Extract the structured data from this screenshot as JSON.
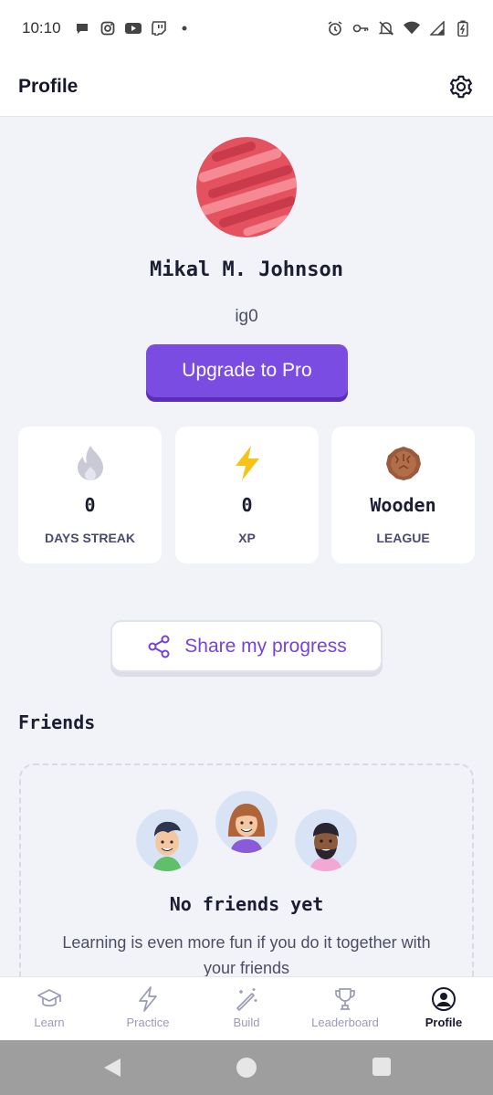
{
  "status_bar": {
    "time": "10:10",
    "notification_icons": [
      "chat-icon",
      "instagram-icon",
      "youtube-icon",
      "twitch-icon",
      "dot-icon"
    ],
    "system_icons": [
      "alarm-icon",
      "key-icon",
      "mute-icon",
      "wifi-icon",
      "signal-icon",
      "battery-icon"
    ]
  },
  "header": {
    "title": "Profile",
    "settings_icon": "gear-icon"
  },
  "profile": {
    "name": "Mikal M. Johnson",
    "username": "ig0",
    "upgrade_label": "Upgrade to Pro",
    "avatar_colors": {
      "base": "#e4525f",
      "stripe": "#f58a94",
      "shadow": "#c93a4a"
    }
  },
  "stats": [
    {
      "icon": "flame-icon",
      "value": "0",
      "label": "DAYS STREAK"
    },
    {
      "icon": "lightning-icon",
      "value": "0",
      "label": "XP"
    },
    {
      "icon": "wooden-badge-icon",
      "value": "Wooden",
      "label": "LEAGUE"
    }
  ],
  "share": {
    "label": "Share my progress",
    "icon": "share-icon"
  },
  "friends": {
    "heading": "Friends",
    "empty_title": "No friends yet",
    "empty_description": "Learning is even more fun if you do it together with your friends"
  },
  "bottom_nav": [
    {
      "label": "Learn",
      "icon": "graduation-cap-icon",
      "active": false
    },
    {
      "label": "Practice",
      "icon": "lightning-outline-icon",
      "active": false
    },
    {
      "label": "Build",
      "icon": "magic-wand-icon",
      "active": false
    },
    {
      "label": "Leaderboard",
      "icon": "trophy-icon",
      "active": false
    },
    {
      "label": "Profile",
      "icon": "user-circle-icon",
      "active": true
    }
  ],
  "colors": {
    "accent": "#7b4ce2",
    "accent_text": "#7643d9",
    "background": "#f2f3f8",
    "xp_yellow": "#f6c31b",
    "wooden_brown": "#9c5a3c"
  }
}
